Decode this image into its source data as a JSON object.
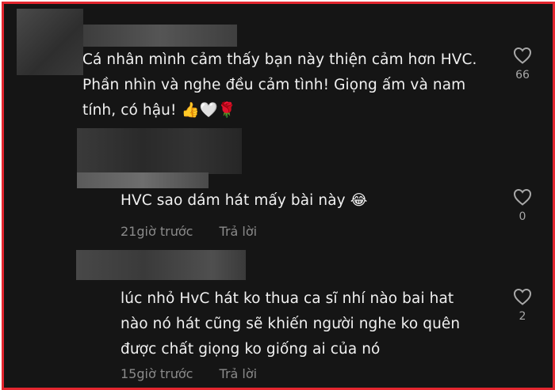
{
  "comments": [
    {
      "lines": [
        "Cá nhân mình cảm thấy bạn này thiện cảm hơn HVC.",
        "Phần nhìn và nghe đều cảm tình! Giọng ấm và nam",
        "tính, có hậu! 👍🤍🌹"
      ],
      "likes": "66"
    },
    {
      "lines": [
        "HVC sao dám hát mấy bài này 😂"
      ],
      "time": "21giờ trước",
      "reply": "Trả lời",
      "likes": "0"
    },
    {
      "lines": [
        "lúc nhỏ HvC hát ko thua ca sĩ nhí nào bai hat",
        "nào nó hát cũng sẽ khiến người nghe ko quên",
        "được chất giọng ko giống ai của nó"
      ],
      "time": "15giờ trước",
      "reply": "Trả lời",
      "likes": "2"
    }
  ],
  "colors": {
    "border": "#e3262f",
    "background": "#151515",
    "text": "#f1f1f1",
    "muted": "#8a8a8a"
  },
  "icons": {
    "like": "heart-icon"
  }
}
